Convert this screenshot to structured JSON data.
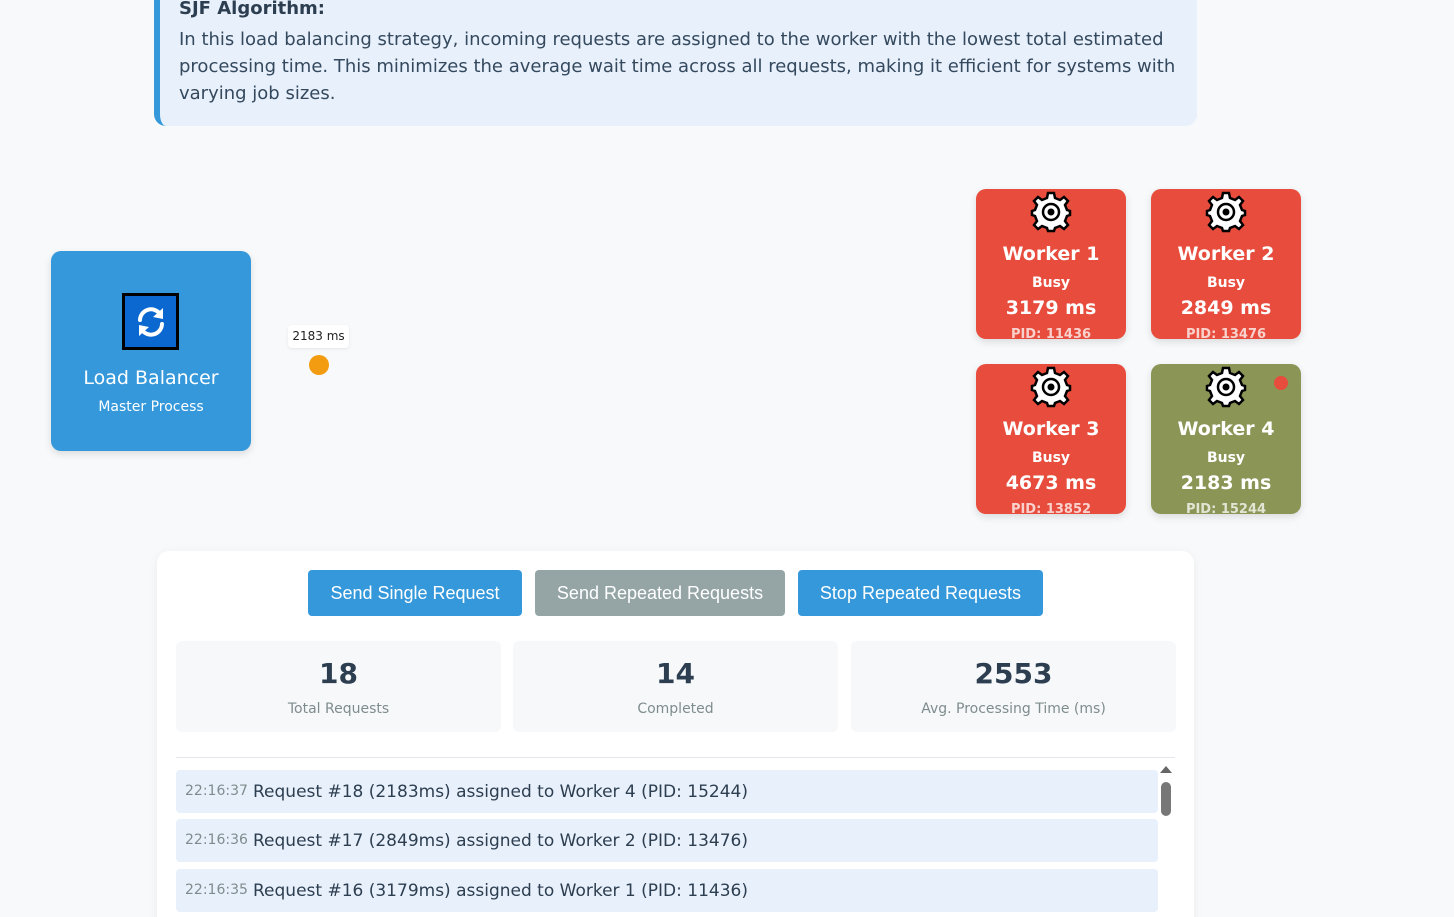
{
  "algorithm": {
    "title": "SJF Algorithm:",
    "description": "In this load balancing strategy, incoming requests are assigned to the worker with the lowest total estimated processing time. This minimizes the average wait time across all requests, making it efficient for systems with varying job sizes."
  },
  "load_balancer": {
    "title": "Load Balancer",
    "subtitle": "Master Process",
    "icon": "sync-icon"
  },
  "in_flight_request": {
    "label": "2183 ms",
    "color": "#f39c12"
  },
  "workers": [
    {
      "name": "Worker 1",
      "status": "Busy",
      "time": "3179 ms",
      "pid": "PID: 11436",
      "color": "#e74c3c"
    },
    {
      "name": "Worker 2",
      "status": "Busy",
      "time": "2849 ms",
      "pid": "PID: 13476",
      "color": "#e74c3c"
    },
    {
      "name": "Worker 3",
      "status": "Busy",
      "time": "4673 ms",
      "pid": "PID: 13852",
      "color": "#e74c3c"
    },
    {
      "name": "Worker 4",
      "status": "Busy",
      "time": "2183 ms",
      "pid": "PID: 15244",
      "color": "#8b9556"
    }
  ],
  "controls": {
    "send_single": "Send Single Request",
    "send_repeated": "Send Repeated Requests",
    "stop_repeated": "Stop Repeated Requests"
  },
  "stats": [
    {
      "value": "18",
      "label": "Total Requests"
    },
    {
      "value": "14",
      "label": "Completed"
    },
    {
      "value": "2553",
      "label": "Avg. Processing Time (ms)"
    }
  ],
  "log": [
    {
      "time": "22:16:37",
      "message": "Request #18 (2183ms) assigned to Worker 4 (PID: 15244)"
    },
    {
      "time": "22:16:36",
      "message": "Request #17 (2849ms) assigned to Worker 2 (PID: 13476)"
    },
    {
      "time": "22:16:35",
      "message": "Request #16 (3179ms) assigned to Worker 1 (PID: 11436)"
    }
  ]
}
